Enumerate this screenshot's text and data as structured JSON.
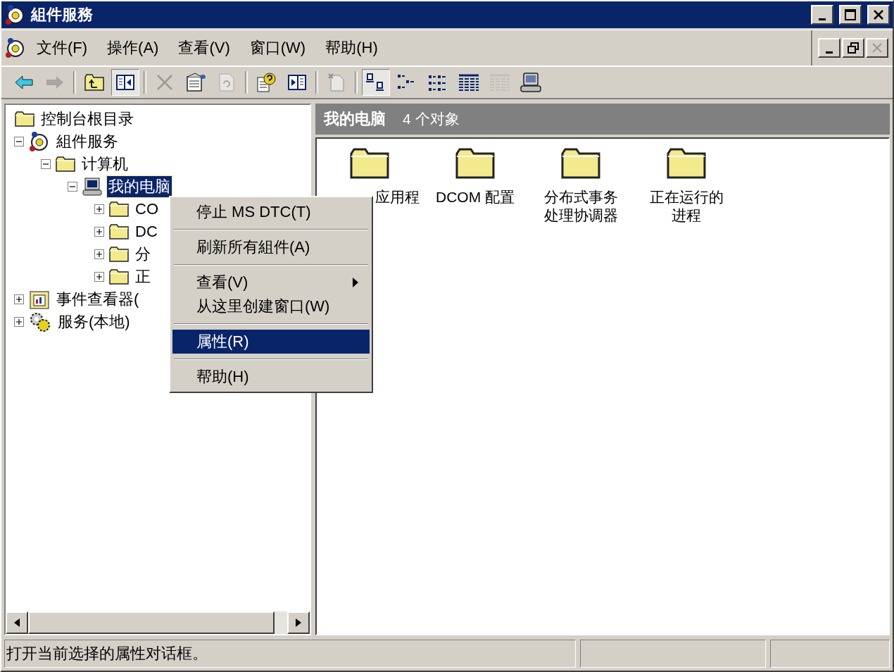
{
  "window": {
    "title": "組件服務"
  },
  "menu_bar": [
    {
      "label": "文件(F)"
    },
    {
      "label": "操作(A)"
    },
    {
      "label": "查看(V)"
    },
    {
      "label": "窗口(W)"
    },
    {
      "label": "帮助(H)"
    }
  ],
  "toolbar": [
    [
      {
        "kind": "back",
        "pressed": false,
        "disabled": false
      },
      {
        "kind": "forward",
        "pressed": false,
        "disabled": true
      }
    ],
    [
      {
        "kind": "up",
        "pressed": false,
        "disabled": false
      },
      {
        "kind": "tree",
        "pressed": true,
        "disabled": false
      }
    ],
    [
      {
        "kind": "delete",
        "pressed": false,
        "disabled": true
      },
      {
        "kind": "properties",
        "pressed": false,
        "disabled": false
      },
      {
        "kind": "refresh",
        "pressed": false,
        "disabled": true
      }
    ],
    [
      {
        "kind": "help",
        "pressed": false,
        "disabled": false
      },
      {
        "kind": "pane",
        "pressed": false,
        "disabled": false
      }
    ],
    [
      {
        "kind": "new",
        "pressed": false,
        "disabled": true
      }
    ],
    [
      {
        "kind": "large",
        "pressed": true,
        "disabled": false
      },
      {
        "kind": "small",
        "pressed": false,
        "disabled": false
      },
      {
        "kind": "list",
        "pressed": false,
        "disabled": false
      },
      {
        "kind": "detail",
        "pressed": false,
        "disabled": false
      },
      {
        "kind": "detail2",
        "pressed": false,
        "disabled": true
      },
      {
        "kind": "computer",
        "pressed": false,
        "disabled": false
      }
    ]
  ],
  "tree": [
    {
      "label": "控制台根目录",
      "kind": "folder",
      "selected": false,
      "children": [
        {
          "label": "組件服务",
          "kind": "component",
          "selected": false,
          "expanded": true,
          "children": [
            {
              "label": "计算机",
              "kind": "folder",
              "selected": false,
              "expanded": true,
              "children": [
                {
                  "label": "我的电脑",
                  "kind": "computer",
                  "selected": true,
                  "expanded": true,
                  "children": [
                    {
                      "label": "CO",
                      "kind": "folder",
                      "selected": false,
                      "expanded": false
                    },
                    {
                      "label": "DC",
                      "kind": "folder",
                      "selected": false,
                      "expanded": false
                    },
                    {
                      "label": "分",
                      "kind": "folder",
                      "selected": false,
                      "expanded": false
                    },
                    {
                      "label": "正",
                      "kind": "folder",
                      "selected": false,
                      "expanded": false
                    }
                  ]
                }
              ]
            }
          ]
        },
        {
          "label": "事件查看器(",
          "kind": "event",
          "selected": false,
          "expanded": false
        },
        {
          "label": "服务(本地)",
          "kind": "services",
          "selected": false,
          "expanded": false
        }
      ]
    }
  ],
  "details": {
    "title": "我的电脑",
    "count": "4 个对象",
    "items": [
      {
        "label": "应用程"
      },
      {
        "label": "DCOM 配置"
      },
      {
        "label": "分布式事务处理协调器"
      },
      {
        "label": "正在运行的进程"
      }
    ]
  },
  "context_menu": [
    {
      "kind": "item",
      "label": "停止 MS DTC(T)",
      "selected": false,
      "submenu": false
    },
    {
      "kind": "separator"
    },
    {
      "kind": "item",
      "label": "刷新所有組件(A)",
      "selected": false,
      "submenu": false
    },
    {
      "kind": "separator"
    },
    {
      "kind": "item",
      "label": "查看(V)",
      "selected": false,
      "submenu": true
    },
    {
      "kind": "item",
      "label": "从这里创建窗口(W)",
      "selected": false,
      "submenu": false
    },
    {
      "kind": "separator"
    },
    {
      "kind": "item",
      "label": "属性(R)",
      "selected": true,
      "submenu": false
    },
    {
      "kind": "separator"
    },
    {
      "kind": "item",
      "label": "帮助(H)",
      "selected": false,
      "submenu": false
    }
  ],
  "status_bar": {
    "text": "打开当前选择的属性对话框。"
  }
}
